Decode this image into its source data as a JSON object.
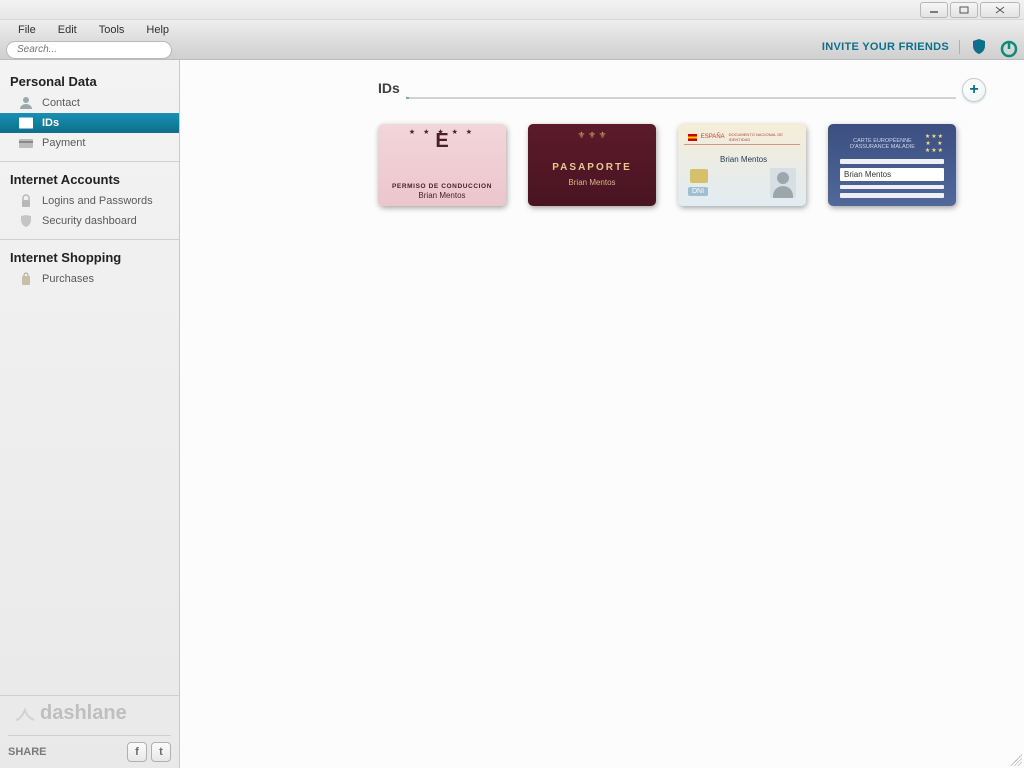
{
  "window": {
    "menus": [
      "File",
      "Edit",
      "Tools",
      "Help"
    ],
    "search_placeholder": "Search...",
    "invite": "INVITE YOUR FRIENDS"
  },
  "sidebar": {
    "sections": [
      {
        "title": "Personal Data",
        "items": [
          {
            "key": "contact",
            "label": "Contact",
            "active": false
          },
          {
            "key": "ids",
            "label": "IDs",
            "active": true
          },
          {
            "key": "payment",
            "label": "Payment",
            "active": false
          }
        ]
      },
      {
        "title": "Internet Accounts",
        "items": [
          {
            "key": "logins",
            "label": "Logins and Passwords",
            "active": false
          },
          {
            "key": "secdash",
            "label": "Security dashboard",
            "active": false
          }
        ]
      },
      {
        "title": "Internet Shopping",
        "items": [
          {
            "key": "purchases",
            "label": "Purchases",
            "active": false
          }
        ]
      }
    ],
    "brand": "dashlane",
    "share": "SHARE"
  },
  "page": {
    "heading": "IDs",
    "cards": {
      "drivers": {
        "title": "PERMISO DE CONDUCCION",
        "holder": "Brian Mentos"
      },
      "passport": {
        "title": "PASAPORTE",
        "holder": "Brian Mentos"
      },
      "national_id": {
        "country": "ESPAÑA",
        "subtitle": "DOCUMENTO NACIONAL DE IDENTIDAD",
        "chip": "DNI",
        "holder": "Brian Mentos"
      },
      "euro_card": {
        "title": "CARTE EUROPÉENNE D'ASSURANCE MALADIE",
        "holder": "Brian Mentos"
      }
    }
  }
}
